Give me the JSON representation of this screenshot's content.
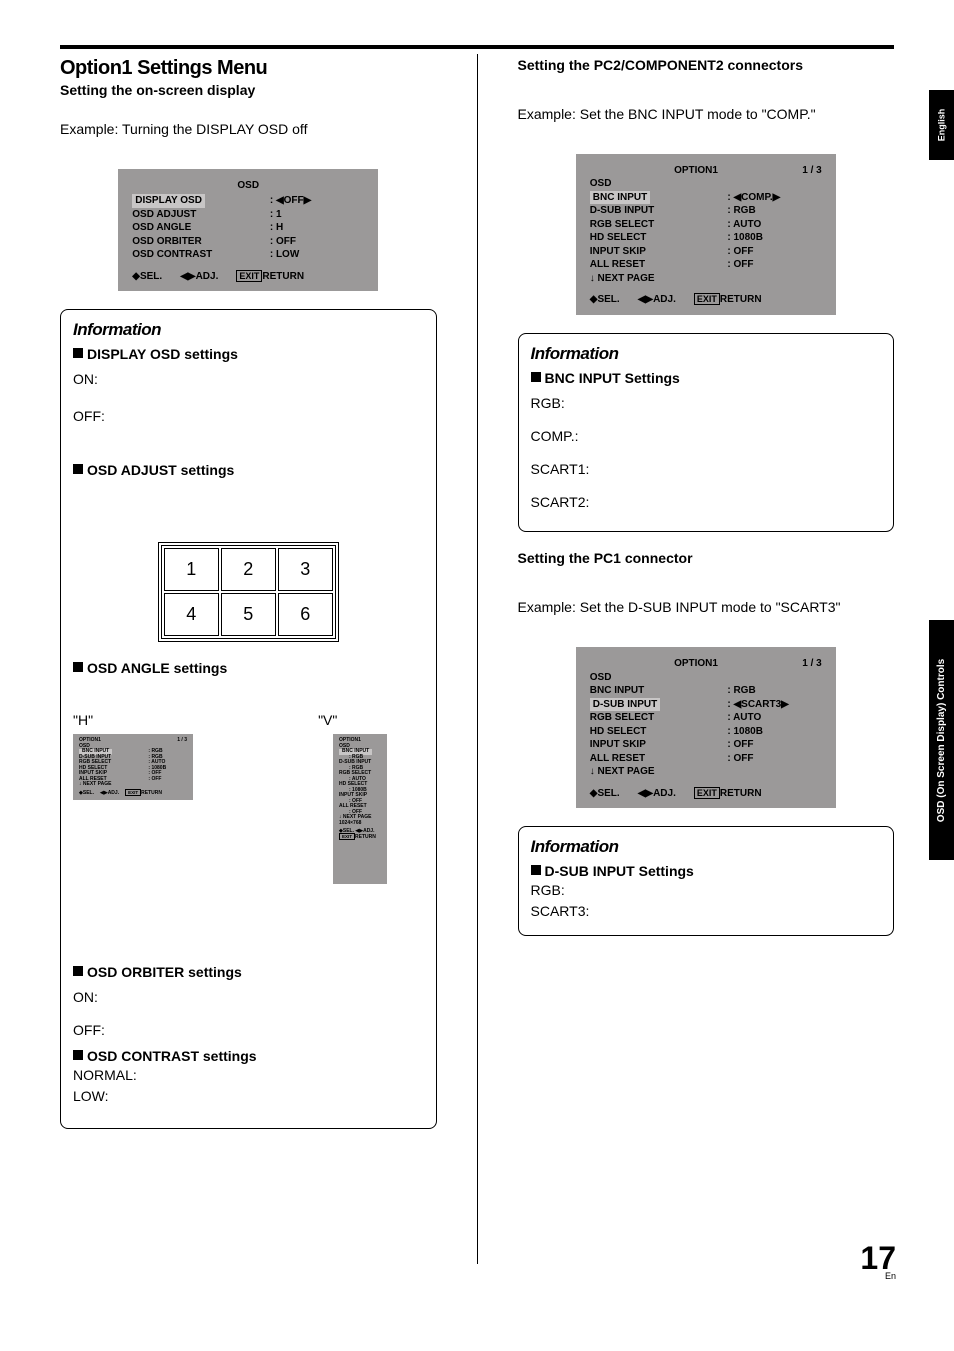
{
  "tabs": {
    "english": "English",
    "osd": "OSD (On Screen Display) Controls"
  },
  "page_number": {
    "num": "17",
    "lang": "En"
  },
  "left": {
    "h_main": "Option1 Settings Menu",
    "h_sub": "Setting the on-screen display",
    "example": "Example: Turning the DISPLAY OSD off",
    "panel_osd": {
      "title": "OSD",
      "rows": [
        {
          "label": "DISPLAY OSD",
          "value": "◀OFF▶",
          "highlight": true
        },
        {
          "label": "OSD ADJUST",
          "value": "1"
        },
        {
          "label": "OSD ANGLE",
          "value": "H"
        },
        {
          "label": "OSD ORBITER",
          "value": "OFF"
        },
        {
          "label": "OSD CONTRAST",
          "value": "LOW"
        }
      ],
      "foot": {
        "sel": "SEL.",
        "adj": "ADJ.",
        "exit": "EXIT",
        "ret": "RETURN"
      }
    },
    "info1": {
      "title": "Information",
      "sec1_head": "DISPLAY OSD settings",
      "on": "ON:",
      "off": "OFF:",
      "sec2_head": "OSD ADJUST settings",
      "picto": [
        [
          "1",
          "2",
          "3"
        ],
        [
          "4",
          "5",
          "6"
        ]
      ],
      "sec3_head": "OSD ANGLE settings",
      "angle_h": "\"H\"",
      "angle_v": "\"V\"",
      "mini_panel": {
        "title": "OPTION1",
        "page": "1 / 3",
        "rows": [
          {
            "label": "OSD",
            "value": ""
          },
          {
            "label": "BNC INPUT",
            "value": "RGB",
            "highlight": true
          },
          {
            "label": "D-SUB INPUT",
            "value": "RGB"
          },
          {
            "label": "RGB SELECT",
            "value": "AUTO"
          },
          {
            "label": "HD SELECT",
            "value": "1080B"
          },
          {
            "label": "INPUT SKIP",
            "value": "OFF"
          },
          {
            "label": "ALL RESET",
            "value": "OFF"
          },
          {
            "label": "↓ NEXT PAGE",
            "value": ""
          }
        ],
        "reset_extra": "1024×768",
        "foot": {
          "sel": "SEL.",
          "adj": "ADJ.",
          "exit": "EXIT",
          "ret": "RETURN"
        }
      },
      "sec4_head": "OSD ORBITER settings",
      "orbiter_on": "ON:",
      "orbiter_off": "OFF:",
      "sec5_head": "OSD CONTRAST settings",
      "normal": "NORMAL:",
      "low": "LOW:"
    }
  },
  "right": {
    "h_sub1": "Setting the PC2/COMPONENT2 connectors",
    "example1": "Example: Set the BNC INPUT mode to \"COMP.\"",
    "panel1": {
      "title": "OPTION1",
      "page": "1 / 3",
      "rows": [
        {
          "label": "OSD",
          "value": ""
        },
        {
          "label": "BNC INPUT",
          "value": "◀COMP.▶",
          "highlight": true
        },
        {
          "label": "D-SUB INPUT",
          "value": "RGB"
        },
        {
          "label": "RGB SELECT",
          "value": "AUTO"
        },
        {
          "label": "HD SELECT",
          "value": "1080B"
        },
        {
          "label": "INPUT SKIP",
          "value": "OFF"
        },
        {
          "label": "ALL RESET",
          "value": "OFF"
        },
        {
          "label": "↓ NEXT PAGE",
          "value": ""
        }
      ],
      "foot": {
        "sel": "SEL.",
        "adj": "ADJ.",
        "exit": "EXIT",
        "ret": "RETURN"
      }
    },
    "info1": {
      "title": "Information",
      "head": "BNC INPUT Settings",
      "rgb": "RGB:",
      "comp": "COMP.:",
      "sc1": "SCART1:",
      "sc2": "SCART2:"
    },
    "h_sub2": "Setting the PC1 connector",
    "example2": "Example: Set the D-SUB INPUT mode to \"SCART3\"",
    "panel2": {
      "title": "OPTION1",
      "page": "1 / 3",
      "rows": [
        {
          "label": "OSD",
          "value": ""
        },
        {
          "label": "BNC INPUT",
          "value": "RGB"
        },
        {
          "label": "D-SUB INPUT",
          "value": "◀SCART3▶",
          "highlight": true
        },
        {
          "label": "RGB SELECT",
          "value": "AUTO"
        },
        {
          "label": "HD SELECT",
          "value": "1080B"
        },
        {
          "label": "INPUT SKIP",
          "value": "OFF"
        },
        {
          "label": "ALL RESET",
          "value": "OFF"
        },
        {
          "label": "↓ NEXT PAGE",
          "value": ""
        }
      ],
      "foot": {
        "sel": "SEL.",
        "adj": "ADJ.",
        "exit": "EXIT",
        "ret": "RETURN"
      }
    },
    "info2": {
      "title": "Information",
      "head": "D-SUB INPUT Settings",
      "rgb": "RGB:",
      "sc3": "SCART3:"
    }
  }
}
